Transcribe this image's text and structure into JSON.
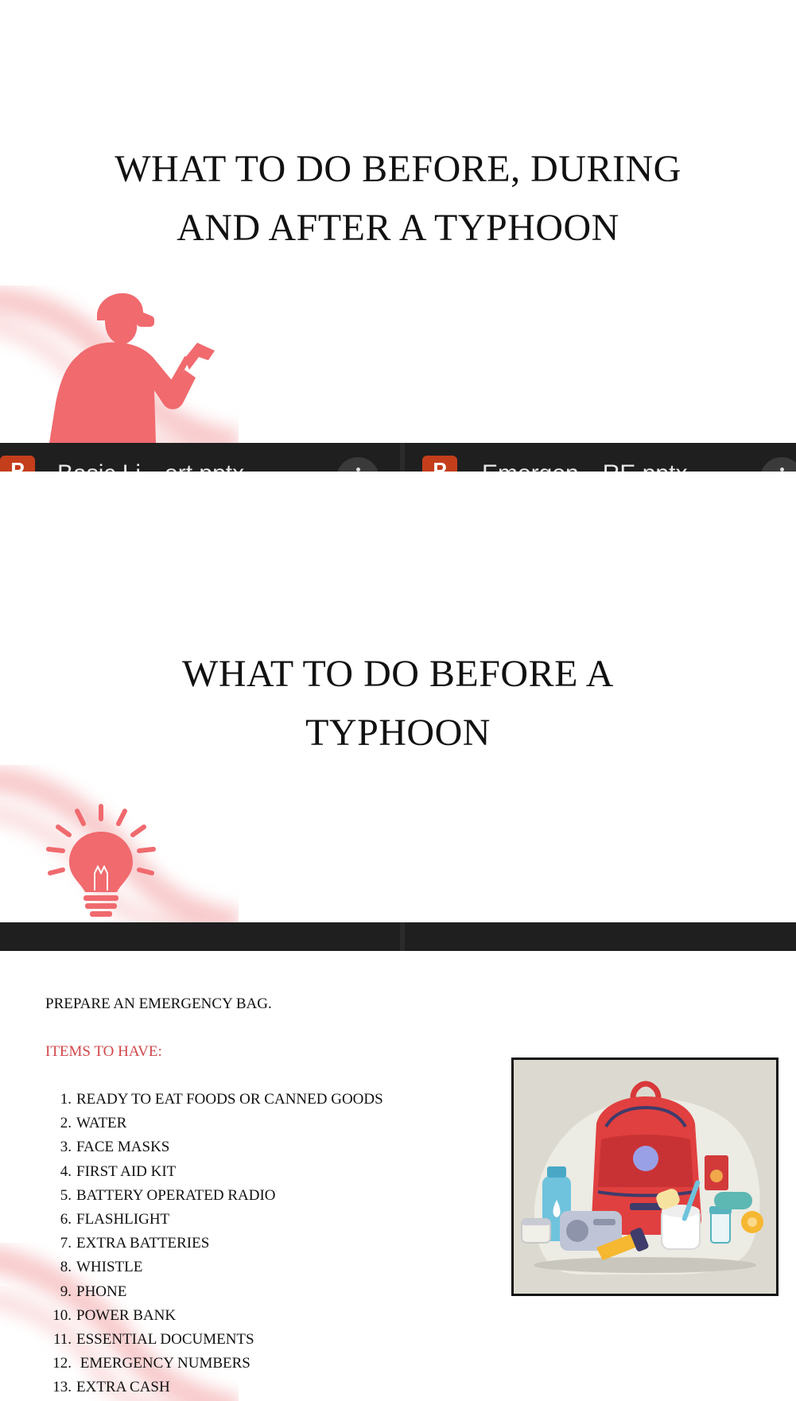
{
  "slides": {
    "slide1": {
      "title_line1": "WHAT TO DO BEFORE, DURING",
      "title_line2": "AND AFTER A TYPHOON"
    },
    "slide2": {
      "title_line1": "WHAT TO DO BEFORE A",
      "title_line2": "TYPHOON"
    },
    "slide3": {
      "intro": "PREPARE AN EMERGENCY BAG.",
      "items_heading": "ITEMS TO HAVE:",
      "items": [
        {
          "num": "1.",
          "text": "READY TO EAT FOODS OR CANNED GOODS"
        },
        {
          "num": "2.",
          "text": "WATER"
        },
        {
          "num": "3.",
          "text": "FACE MASKS"
        },
        {
          "num": "4.",
          "text": "FIRST AID KIT"
        },
        {
          "num": "5.",
          "text": "BATTERY OPERATED RADIO"
        },
        {
          "num": "6.",
          "text": "FLASHLIGHT"
        },
        {
          "num": "7.",
          "text": "EXTRA BATTERIES"
        },
        {
          "num": "8.",
          "text": "WHISTLE"
        },
        {
          "num": "9.",
          "text": "PHONE"
        },
        {
          "num": "10.",
          "text": "POWER BANK"
        },
        {
          "num": "11.",
          "text": "ESSENTIAL DOCUMENTS"
        },
        {
          "num": "12.",
          "text": " EMERGENCY NUMBERS"
        },
        {
          "num": "13.",
          "text": "EXTRA CASH"
        }
      ]
    }
  },
  "file_tiles": [
    {
      "icon_letter": "P",
      "name": "Basic Li…ort.pptx"
    },
    {
      "icon_letter": "P",
      "name": "Emergen…RE.pptx"
    }
  ],
  "icons": {
    "firefighter": "firefighter-icon",
    "lightbulb": "lightbulb-icon",
    "emergency_bag": "emergency-bag-illustration",
    "more": "more-options-icon"
  },
  "colors": {
    "accent_red": "#f06a6e",
    "heading_red": "#d2474b",
    "bar": "#1f1f1f"
  }
}
